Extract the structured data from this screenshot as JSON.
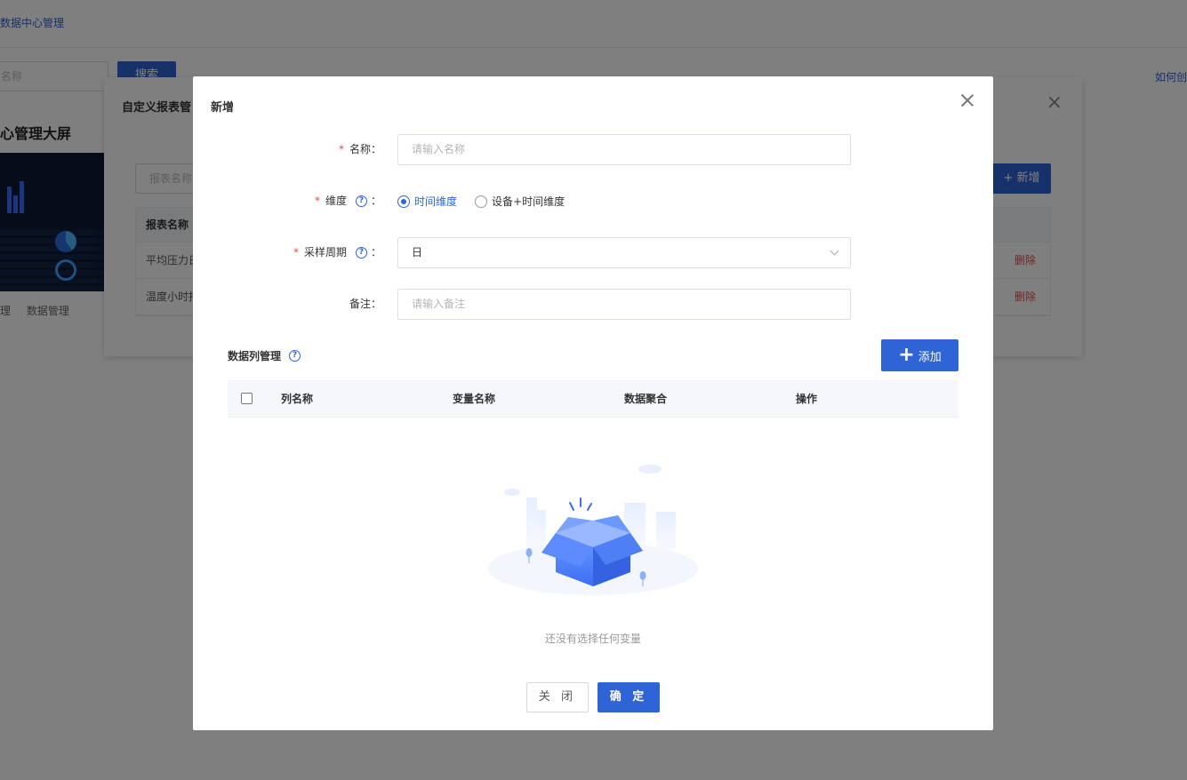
{
  "background": {
    "breadcrumb": "数据中心管理",
    "search_placeholder": "名称",
    "search_button": "搜索",
    "help_link": "如何创",
    "card_title": "心管理大屏",
    "card_tabs": [
      "理",
      "数据管理"
    ],
    "dialog": {
      "title": "自定义报表管",
      "search_placeholder": "报表名称",
      "add_button": "新增",
      "table_header": "报表名称",
      "rows": [
        {
          "name": "平均压力日",
          "action": "删除"
        },
        {
          "name": "温度小时报",
          "action": "删除"
        }
      ]
    }
  },
  "modal": {
    "title": "新增",
    "fields": {
      "name": {
        "label": "名称：",
        "placeholder": "请输入名称"
      },
      "dimension": {
        "label": "维度",
        "colon": "：",
        "options": [
          "时间维度",
          "设备+时间维度"
        ],
        "selected": "时间维度"
      },
      "period": {
        "label": "采样周期",
        "colon": "：",
        "value": "日"
      },
      "remark": {
        "label": "备注：",
        "placeholder": "请输入备注"
      }
    },
    "columns_section": {
      "title": "数据列管理",
      "add_button": "添加",
      "table_columns": [
        "列名称",
        "变量名称",
        "数据聚合",
        "操作"
      ],
      "empty_text": "还没有选择任何变量"
    },
    "footer": {
      "close_button": "关 闭",
      "ok_button": "确 定"
    }
  },
  "colors": {
    "primary": "#2f64d6",
    "danger": "#e04b4b",
    "mask": "rgba(0,0,0,0.5)"
  }
}
